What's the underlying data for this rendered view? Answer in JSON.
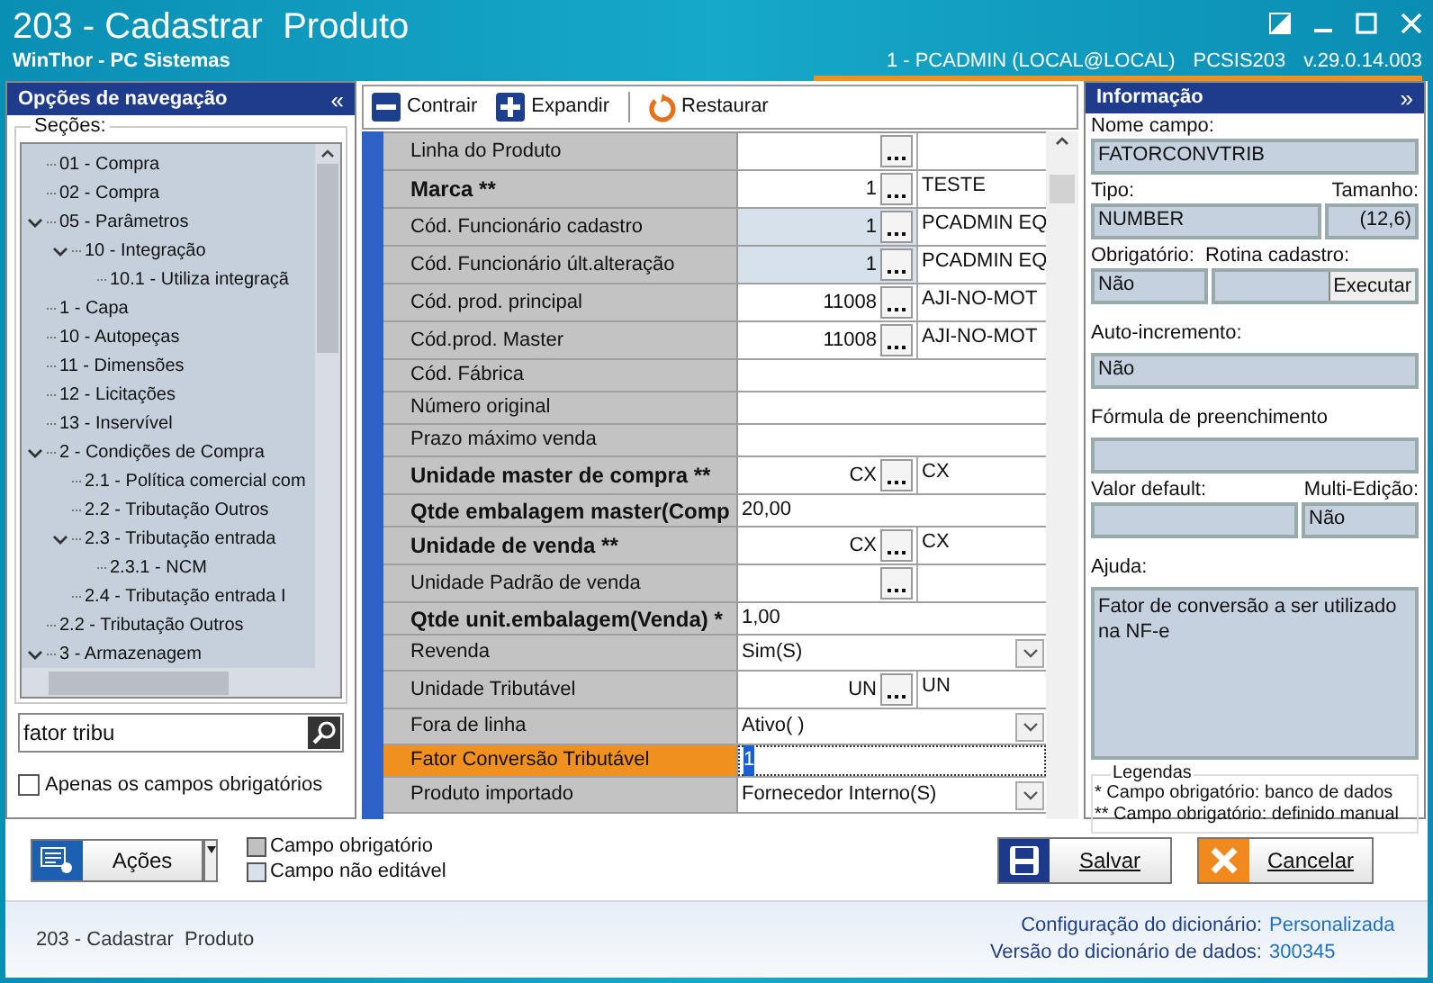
{
  "window": {
    "title": "203 - Cadastrar  Produto",
    "subtitle": "WinThor - PC Sistemas",
    "user": "1 - PCADMIN (LOCAL@LOCAL)",
    "routine": "PCSIS203",
    "version": "v.29.0.14.003"
  },
  "navigation": {
    "title": "Opções de navegação",
    "collapse": "«",
    "sections_label": "Seções:",
    "sections": [
      {
        "label": "01 - Compra"
      },
      {
        "label": "02 - Compra"
      },
      {
        "label": "05 - Parâmetros",
        "expanded": true,
        "children": [
          {
            "label": "10 - Integração",
            "expanded": true,
            "children": [
              {
                "label": "10.1 - Utiliza integraçã"
              }
            ]
          }
        ]
      },
      {
        "label": "1 - Capa"
      },
      {
        "label": "10 - Autopeças"
      },
      {
        "label": "11 - Dimensões"
      },
      {
        "label": "12 - Licitações"
      },
      {
        "label": "13 - Inservível"
      },
      {
        "label": "2 - Condições de Compra",
        "expanded": true,
        "children": [
          {
            "label": "2.1 - Política comercial com"
          },
          {
            "label": "2.2 - Tributação Outros"
          },
          {
            "label": "2.3 - Tributação entrada",
            "expanded": true,
            "children": [
              {
                "label": "2.3.1 - NCM"
              }
            ]
          },
          {
            "label": "2.4 - Tributação entrada I"
          }
        ]
      },
      {
        "label": "2.2 - Tributação Outros"
      },
      {
        "label": "3 - Armazenagem",
        "expanded": true
      }
    ],
    "search": {
      "value": "fator tribu"
    },
    "only_required": {
      "label": "Apenas os campos obrigatórios",
      "checked": false
    }
  },
  "toolbar": [
    {
      "kind": "collapse",
      "label": "Contrair"
    },
    {
      "kind": "expand",
      "label": "Expandir"
    },
    {
      "kind": "restore",
      "label": "Restaurar"
    }
  ],
  "form": {
    "rows": [
      {
        "kind": "lookup",
        "label": "Linha do Produto",
        "bold": false,
        "editable": true,
        "selected": false
      },
      {
        "kind": "lookup",
        "label": "Marca **",
        "bold": true,
        "editable": true,
        "selected": false,
        "code": "1",
        "description": "TESTE"
      },
      {
        "kind": "lookup",
        "label": "Cód. Funcionário cadastro",
        "bold": false,
        "editable": false,
        "selected": false,
        "code": "1",
        "description": "PCADMIN EQ"
      },
      {
        "kind": "lookup",
        "label": "Cód. Funcionário últ.alteração",
        "bold": false,
        "editable": false,
        "selected": false,
        "code": "1",
        "description": "PCADMIN EQ"
      },
      {
        "kind": "lookup",
        "label": "Cód. prod. principal",
        "bold": false,
        "editable": true,
        "selected": false,
        "code": "11008",
        "description": "AJI-NO-MOT"
      },
      {
        "kind": "lookup",
        "label": "Cód.prod. Master",
        "bold": false,
        "editable": true,
        "selected": false,
        "code": "11008",
        "description": "AJI-NO-MOT"
      },
      {
        "kind": "text",
        "label": "Cód. Fábrica",
        "bold": false,
        "editable": true,
        "selected": false
      },
      {
        "kind": "text",
        "label": "Número original",
        "bold": false,
        "editable": true,
        "selected": false
      },
      {
        "kind": "text",
        "label": "Prazo máximo venda",
        "bold": false,
        "editable": true,
        "selected": false
      },
      {
        "kind": "lookup",
        "label": "Unidade master de compra **",
        "bold": true,
        "editable": true,
        "selected": false,
        "code": "CX",
        "description": "CX"
      },
      {
        "kind": "text",
        "label": "Qtde embalagem master(Comp",
        "bold": true,
        "editable": true,
        "selected": false,
        "value": "20,00"
      },
      {
        "kind": "lookup",
        "label": "Unidade de venda **",
        "bold": true,
        "editable": true,
        "selected": false,
        "code": "CX",
        "description": "CX"
      },
      {
        "kind": "lookup",
        "label": "Unidade Padrão de venda",
        "bold": false,
        "editable": true,
        "selected": false
      },
      {
        "kind": "text",
        "label": "Qtde unit.embalagem(Venda) *",
        "bold": true,
        "editable": true,
        "selected": false,
        "value": "1,00"
      },
      {
        "kind": "select",
        "label": "Revenda",
        "bold": false,
        "editable": true,
        "selected": false,
        "value": "Sim(S)"
      },
      {
        "kind": "lookup",
        "label": "Unidade Tributável",
        "bold": false,
        "editable": true,
        "selected": false,
        "code": "UN",
        "description": "UN"
      },
      {
        "kind": "select",
        "label": "Fora de linha",
        "bold": false,
        "editable": true,
        "selected": false,
        "value": "Ativo( )"
      },
      {
        "kind": "text",
        "label": "Fator Conversão Tributável",
        "bold": false,
        "editable": true,
        "selected": true,
        "value": "1"
      },
      {
        "kind": "select",
        "label": "Produto importado",
        "bold": false,
        "editable": true,
        "selected": false,
        "value": "Fornecedor Interno(S)"
      }
    ]
  },
  "info": {
    "title": "Informação",
    "expand": "»",
    "field_name_label": "Nome campo:",
    "field_name": "FATORCONVTRIB",
    "type_label": "Tipo:",
    "type": "NUMBER",
    "size_label": "Tamanho:",
    "size": "(12,6)",
    "required_label": "Obrigatório:",
    "required": "Não",
    "routine_label": "Rotina cadastro:",
    "execute_button": "Executar",
    "autoincrement_label": "Auto-incremento:",
    "autoincrement": "Não",
    "formula_label": "Fórmula de preenchimento",
    "default_label": "Valor default:",
    "multi_edit_label": "Multi-Edição:",
    "multi_edit": "Não",
    "help_label": "Ajuda:",
    "help": "Fator de conversão a ser utilizado na NF-e",
    "legend_title": "Legendas",
    "legend": [
      "* Campo obrigatório: banco de dados",
      "** Campo obrigatório: definido manual"
    ]
  },
  "actions": {
    "label": "Ações"
  },
  "field_legend": [
    {
      "label": "Campo obrigatório",
      "color": "#c0c0c0"
    },
    {
      "label": "Campo não editável",
      "color": "#d6e1ec"
    }
  ],
  "buttons": [
    {
      "kind": "save",
      "label": "Salvar"
    },
    {
      "kind": "cancel",
      "label": "Cancelar"
    }
  ],
  "footer": {
    "routine": "203 - Cadastrar  Produto",
    "config_label": "Configuração do dicionário:",
    "config": "Personalizada",
    "version_label": "Versão do dicionário de dados:",
    "version": "300345"
  }
}
